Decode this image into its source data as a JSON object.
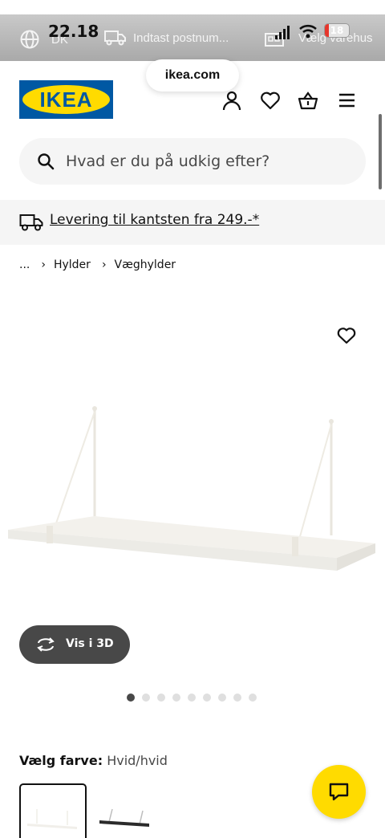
{
  "status_bar": {
    "time": "22.18",
    "battery_level": "18",
    "battery_fraction": 0.18
  },
  "util_bar": {
    "language_label": "DK",
    "postcode_placeholder": "Indtast postnum...",
    "store_label": "Vælg varehus"
  },
  "browser": {
    "url": "ikea.com"
  },
  "header": {
    "logo_text": "IKEA",
    "brand_colors": {
      "blue": "#0058a3",
      "yellow": "#ffdb00"
    },
    "icons": [
      "user-icon",
      "heart-icon",
      "basket-icon",
      "menu-icon"
    ]
  },
  "search": {
    "placeholder": "Hvad er du på udkig efter?"
  },
  "delivery": {
    "text": "Levering til kantsten fra 249.-*"
  },
  "breadcrumb": {
    "items": [
      "...",
      "Hylder",
      "Væghylder"
    ]
  },
  "product": {
    "view_3d_label": "Vis i 3D",
    "image_count": 9,
    "active_image_index": 0,
    "color_label": "Vælg farve:",
    "color_value": "Hvid/hvid",
    "swatches": [
      "Hvid/hvid",
      "Sort"
    ]
  },
  "chat": {
    "icon": "chat-icon"
  }
}
